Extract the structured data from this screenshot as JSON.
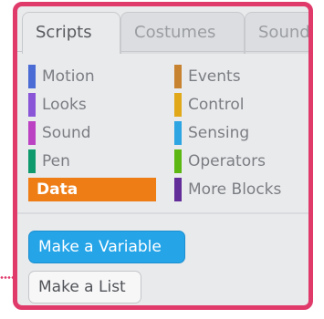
{
  "tabs": [
    {
      "label": "Scripts"
    },
    {
      "label": "Costumes"
    },
    {
      "label": "Sounds"
    }
  ],
  "categories": [
    {
      "label": "Motion",
      "color": "#4a6cd4"
    },
    {
      "label": "Looks",
      "color": "#8a55d7"
    },
    {
      "label": "Sound",
      "color": "#bb42c3"
    },
    {
      "label": "Pen",
      "color": "#0e9a6c"
    },
    {
      "label": "Data",
      "color": "#ee7d16",
      "selected": true
    },
    {
      "label": "Events",
      "color": "#c88330"
    },
    {
      "label": "Control",
      "color": "#e1a91a"
    },
    {
      "label": "Sensing",
      "color": "#2ca5e2"
    },
    {
      "label": "Operators",
      "color": "#5cb712"
    },
    {
      "label": "More Blocks",
      "color": "#632d99"
    }
  ],
  "buttons": {
    "make_variable": "Make a Variable",
    "make_list": "Make a List"
  },
  "colors": {
    "highlight": "#e03a6b",
    "data_selected": "#ee7d16",
    "variable_button": "#25a4e8"
  }
}
